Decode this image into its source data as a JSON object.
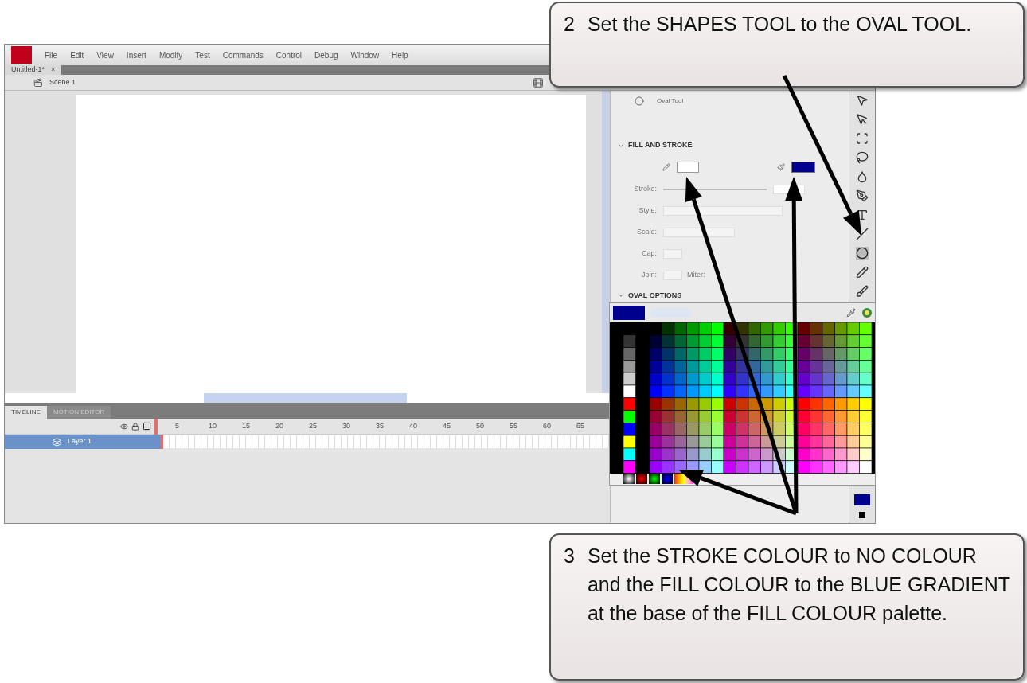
{
  "menu": [
    "File",
    "Edit",
    "View",
    "Insert",
    "Modify",
    "Test",
    "Commands",
    "Control",
    "Debug",
    "Window",
    "Help"
  ],
  "document_tab": {
    "label": "Untitled-1*",
    "close": "×"
  },
  "edit_bar": {
    "scene": "Scene 1"
  },
  "properties": {
    "tool_name": "Oval Tool",
    "sections": [
      {
        "title": "FILL AND STROKE",
        "expanded": true
      },
      {
        "title": "OVAL OPTIONS",
        "expanded": true
      }
    ],
    "stroke_label": "Stroke:",
    "style_label": "Style:",
    "scale_label": "Scale:",
    "cap_label": "Cap:",
    "join_label": "Join:",
    "miter_label": "Miter:"
  },
  "timeline": {
    "tabs": [
      {
        "label": "TIMELINE",
        "selected": true
      },
      {
        "label": "MOTION EDITOR",
        "selected": false
      }
    ],
    "frame_numbers": [
      "5",
      "10",
      "15",
      "20",
      "25",
      "30",
      "35",
      "40",
      "45",
      "50",
      "55",
      "60",
      "65"
    ],
    "layers": [
      {
        "name": "Layer 1",
        "selected": true
      }
    ]
  },
  "callouts": [
    {
      "number": "2",
      "text": "Set the SHAPES TOOL to the OVAL TOOL."
    },
    {
      "number": "3",
      "text": "Set the STROKE COLOUR to NO COLOUR and the FILL COLOUR to the BLUE GRADIENT at the base of the FILL COLOUR palette."
    }
  ]
}
